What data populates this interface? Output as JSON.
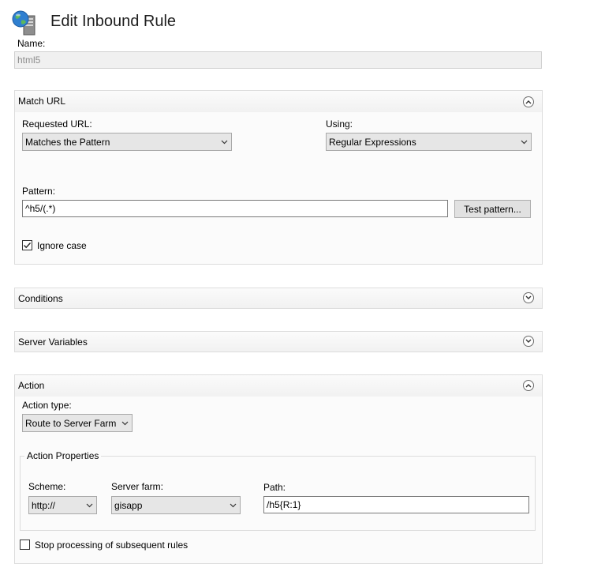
{
  "header": {
    "title": "Edit Inbound Rule",
    "icon": "globe-server-icon"
  },
  "name_field": {
    "label": "Name:",
    "value": "html5"
  },
  "match_url": {
    "title": "Match URL",
    "requested_url_label": "Requested URL:",
    "requested_url_value": "Matches the Pattern",
    "using_label": "Using:",
    "using_value": "Regular Expressions",
    "pattern_label": "Pattern:",
    "pattern_value": "^h5/(.*)",
    "test_pattern_button": "Test pattern...",
    "ignore_case_label": "Ignore case",
    "ignore_case_checked": true
  },
  "conditions": {
    "title": "Conditions"
  },
  "server_variables": {
    "title": "Server Variables"
  },
  "action": {
    "title": "Action",
    "action_type_label": "Action type:",
    "action_type_value": "Route to Server Farm",
    "properties_title": "Action Properties",
    "scheme_label": "Scheme:",
    "scheme_value": "http://",
    "server_farm_label": "Server farm:",
    "server_farm_value": "gisapp",
    "path_label": "Path:",
    "path_value": "/h5{R:1}",
    "stop_processing_label": "Stop processing of subsequent rules",
    "stop_processing_checked": false
  },
  "colors": {
    "panel_bg": "#fbfbfb",
    "panel_border": "#dcdcdc",
    "select_bg": "#e6e6e6",
    "disabled_text": "#8c8c8c"
  }
}
